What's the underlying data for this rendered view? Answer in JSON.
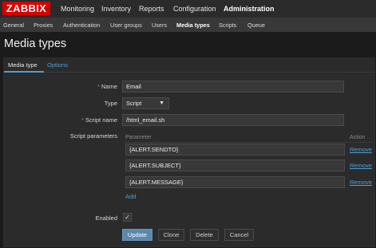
{
  "brand": {
    "logo": "ZABBIX",
    "accent": "#d40000",
    "link_color": "#4f9fd8"
  },
  "top_nav": [
    "Monitoring",
    "Inventory",
    "Reports",
    "Configuration",
    "Administration"
  ],
  "sub_nav": [
    "General",
    "Proxies",
    "Authentication",
    "User groups",
    "Users",
    "Media types",
    "Scripts",
    "Queue"
  ],
  "page": {
    "title": "Media types"
  },
  "tabs": {
    "media_type": "Media type",
    "options": "Options"
  },
  "form": {
    "name_label": "Name",
    "name_value": "Email",
    "type_label": "Type",
    "type_value": "Script",
    "script_name_label": "Script name",
    "script_name_value": "/html_email.sh",
    "script_params_label": "Script parameters",
    "param_col_header": "Parameter",
    "action_col_header": "Action",
    "params": [
      "{ALERT.SENDTO}",
      "{ALERT.SUBJECT}",
      "{ALERT.MESSAGE}"
    ],
    "remove_label": "Remove",
    "add_label": "Add",
    "enabled_label": "Enabled",
    "enabled_checked": "✓"
  },
  "buttons": {
    "update": "Update",
    "clone": "Clone",
    "delete": "Delete",
    "cancel": "Cancel"
  }
}
